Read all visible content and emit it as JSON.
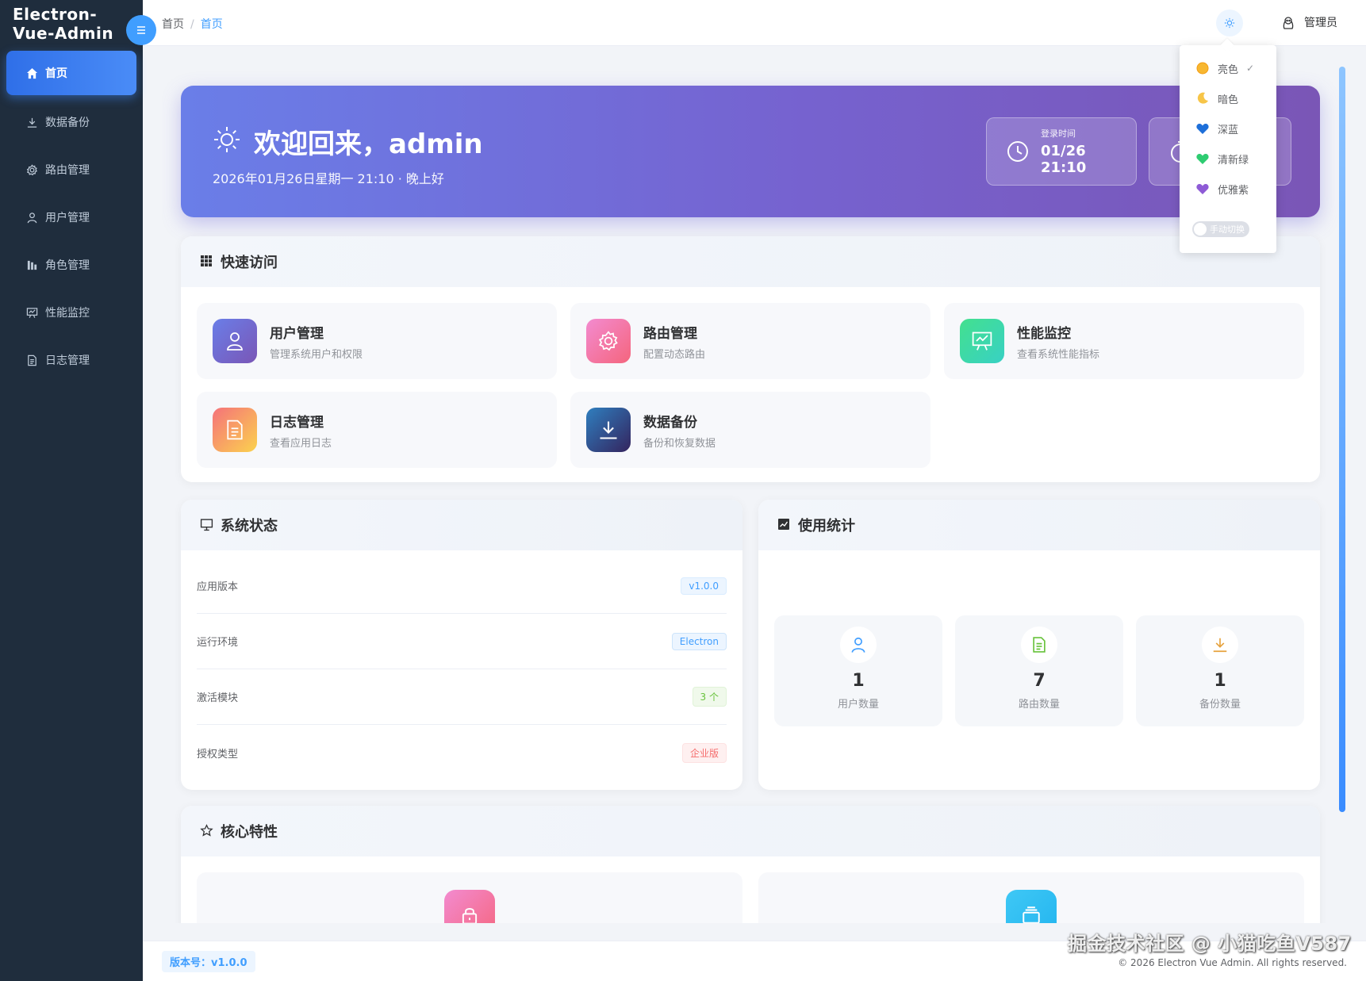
{
  "app": {
    "logo": "Electron-Vue-Admin"
  },
  "sidebar": {
    "items": [
      {
        "label": "首页",
        "icon": "home-icon",
        "active": true
      },
      {
        "label": "数据备份",
        "icon": "download-icon"
      },
      {
        "label": "路由管理",
        "icon": "gear-icon"
      },
      {
        "label": "用户管理",
        "icon": "user-icon"
      },
      {
        "label": "角色管理",
        "icon": "role-icon"
      },
      {
        "label": "性能监控",
        "icon": "monitor-chart-icon"
      },
      {
        "label": "日志管理",
        "icon": "document-icon"
      }
    ]
  },
  "header": {
    "breadcrumb": [
      "首页",
      "首页"
    ],
    "breadcrumb_sep": "/",
    "user_name": "管理员"
  },
  "theme_menu": {
    "items": [
      {
        "label": "亮色",
        "icon": "sun-icon",
        "checked": true
      },
      {
        "label": "暗色",
        "icon": "moon-icon"
      },
      {
        "label": "深蓝",
        "icon": "blue-heart-icon"
      },
      {
        "label": "清新绿",
        "icon": "green-heart-icon"
      },
      {
        "label": "优雅紫",
        "icon": "purple-heart-icon"
      }
    ],
    "toggle_label": "手动切换"
  },
  "welcome": {
    "title": "欢迎回来，admin",
    "subtitle": "2026年01月26日星期一 21:10 · 晚上好",
    "login_label": "登录时间",
    "login_value": "01/26 21:10"
  },
  "quick_access": {
    "title": "快速访问",
    "items": [
      {
        "title": "用户管理",
        "desc": "管理系统用户和权限",
        "icon": "user-icon"
      },
      {
        "title": "路由管理",
        "desc": "配置动态路由",
        "icon": "gear-icon"
      },
      {
        "title": "性能监控",
        "desc": "查看系统性能指标",
        "icon": "monitor-chart-icon"
      },
      {
        "title": "日志管理",
        "desc": "查看应用日志",
        "icon": "document-icon"
      },
      {
        "title": "数据备份",
        "desc": "备份和恢复数据",
        "icon": "download-icon"
      }
    ]
  },
  "system_status": {
    "title": "系统状态",
    "rows": [
      {
        "label": "应用版本",
        "value": "v1.0.0"
      },
      {
        "label": "运行环境",
        "value": "Electron"
      },
      {
        "label": "激活模块",
        "value": "3 个"
      },
      {
        "label": "授权类型",
        "value": "企业版"
      }
    ]
  },
  "usage_stats": {
    "title": "使用统计",
    "items": [
      {
        "value": "1",
        "label": "用户数量",
        "icon": "user-icon"
      },
      {
        "value": "7",
        "label": "路由数量",
        "icon": "document-icon"
      },
      {
        "value": "1",
        "label": "备份数量",
        "icon": "download-icon"
      }
    ]
  },
  "core_features": {
    "title": "核心特性"
  },
  "footer": {
    "version": "版本号：v1.0.0",
    "copyright": "© 2026 Electron Vue Admin. All rights reserved."
  },
  "watermark": "掘金技术社区 @ 小猫吃鱼V587",
  "colors": {
    "sidebar_bg": "#1f2d3d",
    "accent": "#409eff",
    "welcome_gradient": [
      "#6a7ee8",
      "#7a56b6"
    ]
  }
}
